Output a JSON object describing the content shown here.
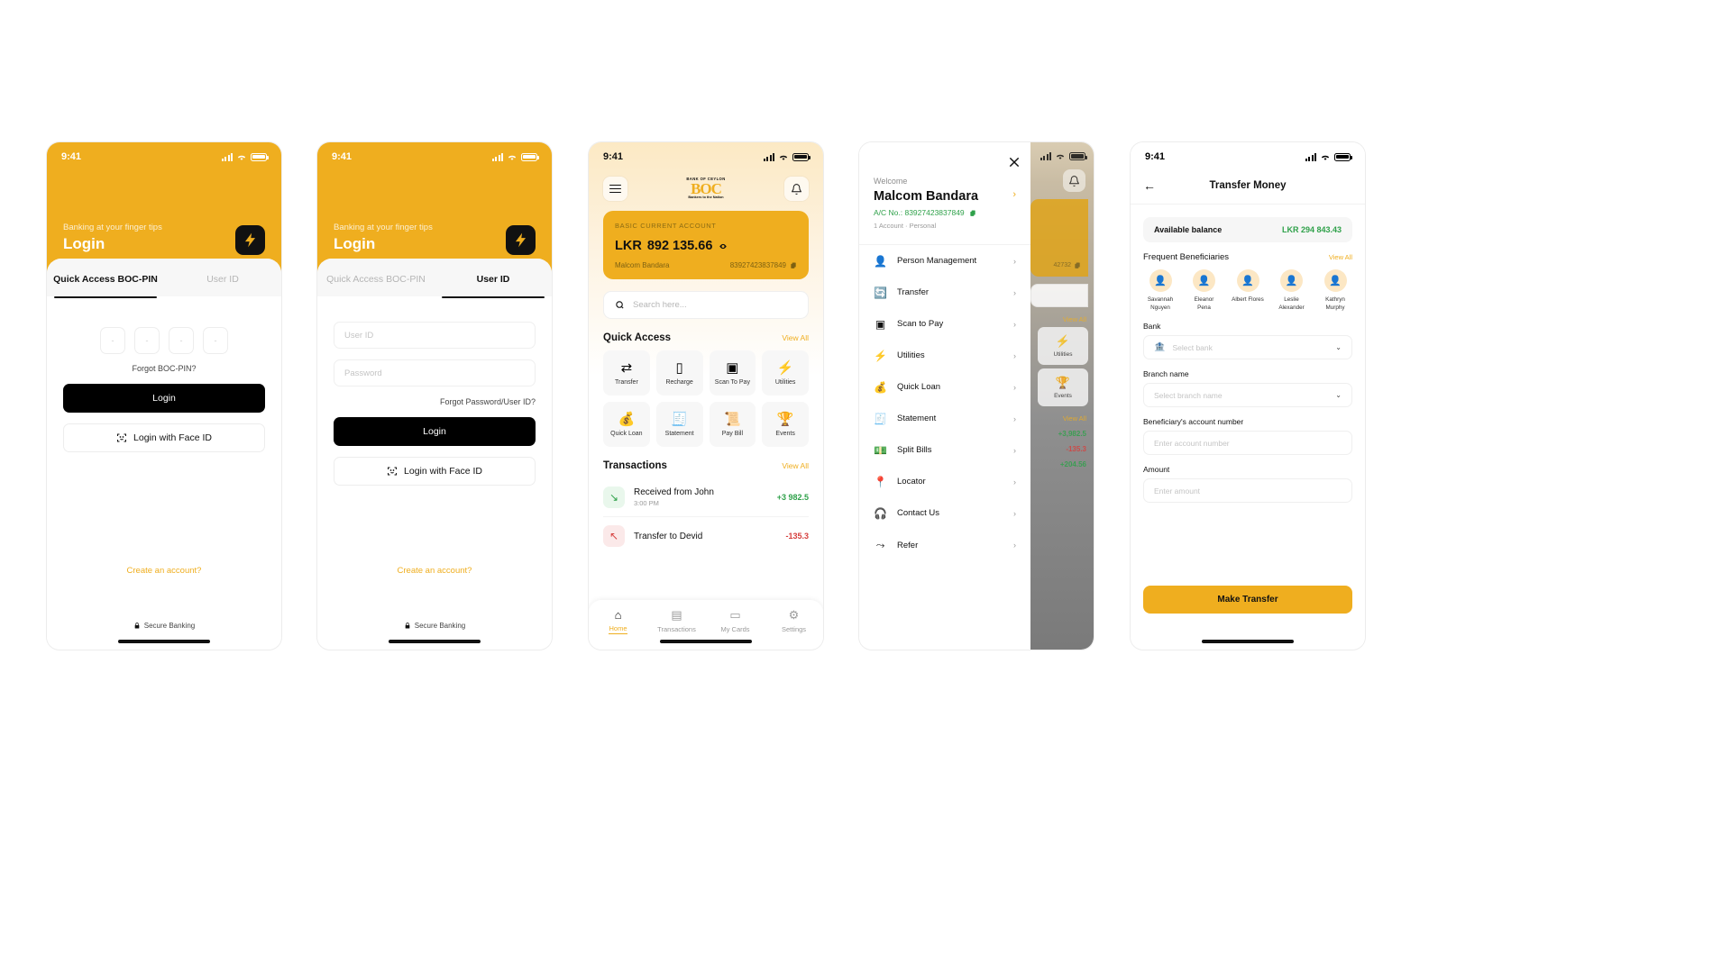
{
  "status_bar": {
    "time": "9:41"
  },
  "screen1": {
    "hero": {
      "subtitle": "Banking at your finger tips",
      "title": "Login",
      "logo_icon": "boc-bolt-logo"
    },
    "tabs": [
      {
        "label": "Quick Access BOC-PIN",
        "active": true
      },
      {
        "label": "User ID",
        "active": false
      }
    ],
    "pin_boxes": [
      "-",
      "-",
      "-",
      "-"
    ],
    "forgot_pin": "Forgot BOC-PIN?",
    "login_button": "Login",
    "faceid_button": "Login with Face ID",
    "create_account": "Create an account?",
    "secure_banking": "Secure Banking"
  },
  "screen2": {
    "hero": {
      "subtitle": "Banking at your finger tips",
      "title": "Login",
      "logo_icon": "boc-bolt-logo"
    },
    "tabs": [
      {
        "label": "Quick Access BOC-PIN",
        "active": false
      },
      {
        "label": "User ID",
        "active": true
      }
    ],
    "fields": [
      {
        "placeholder": "User ID",
        "value": ""
      },
      {
        "placeholder": "Password",
        "value": ""
      }
    ],
    "forgot_link": "Forgot Password/User ID?",
    "login_button": "Login",
    "faceid_button": "Login with Face ID",
    "create_account": "Create an account?",
    "secure_banking": "Secure Banking"
  },
  "screen3": {
    "brand": {
      "top": "BANK OF CEYLON",
      "mid": "BOC",
      "bottom": "Bankers to the Nation"
    },
    "card": {
      "type": "BASIC CURRENT ACCOUNT",
      "currency": "LKR",
      "balance": "892 135.66",
      "holder": "Malcom Bandara",
      "account_number": "83927423837849"
    },
    "search_placeholder": "Search here...",
    "quick_access": {
      "title": "Quick Access",
      "view_all": "View All",
      "items": [
        {
          "label": "Transfer",
          "icon": "transfer-arrows-icon",
          "glyph": "⇄"
        },
        {
          "label": "Recharge",
          "icon": "phone-recharge-icon",
          "glyph": "▯"
        },
        {
          "label": "Scan To Pay",
          "icon": "qr-scan-icon",
          "glyph": "▣"
        },
        {
          "label": "Utilities",
          "icon": "bolt-icon",
          "glyph": "⚡"
        },
        {
          "label": "Quick Loan",
          "icon": "money-bag-icon",
          "glyph": "💰"
        },
        {
          "label": "Statement",
          "icon": "document-icon",
          "glyph": "🧾"
        },
        {
          "label": "Pay Bill",
          "icon": "bill-icon",
          "glyph": "📜"
        },
        {
          "label": "Events",
          "icon": "trophy-icon",
          "glyph": "🏆"
        }
      ]
    },
    "transactions": {
      "title": "Transactions",
      "view_all": "View All",
      "items": [
        {
          "name": "Received from John",
          "time": "3:00 PM",
          "amount": "+3 982.5",
          "direction": "in"
        },
        {
          "name": "Transfer to Devid",
          "time": "",
          "amount": "-135.3",
          "direction": "out"
        }
      ]
    },
    "bottom_nav": [
      {
        "label": "Home",
        "icon": "home-icon",
        "glyph": "⌂",
        "active": true
      },
      {
        "label": "Transactions",
        "icon": "list-icon",
        "glyph": "▤",
        "active": false
      },
      {
        "label": "My Cards",
        "icon": "card-icon",
        "glyph": "▭",
        "active": false
      },
      {
        "label": "Settings",
        "icon": "gear-icon",
        "glyph": "⚙",
        "active": false
      }
    ]
  },
  "screen4": {
    "close_icon": "close-icon",
    "welcome": "Welcome",
    "name": "Malcom Bandara",
    "account_line": "A/C No.: 83927423837849",
    "meta": "1 Account · Personal",
    "menu": [
      {
        "label": "Person Management",
        "icon": "person-icon",
        "glyph": "👤"
      },
      {
        "label": "Transfer",
        "icon": "transfer-icon",
        "glyph": "🔄"
      },
      {
        "label": "Scan to Pay",
        "icon": "qr-scan-icon",
        "glyph": "▣"
      },
      {
        "label": "Utilities",
        "icon": "bolt-icon",
        "glyph": "⚡"
      },
      {
        "label": "Quick Loan",
        "icon": "money-bag-icon",
        "glyph": "💰"
      },
      {
        "label": "Statement",
        "icon": "document-icon",
        "glyph": "🧾"
      },
      {
        "label": "Split Bills",
        "icon": "split-bill-icon",
        "glyph": "💵"
      },
      {
        "label": "Locator",
        "icon": "location-pin-icon",
        "glyph": "📍"
      },
      {
        "label": "Contact Us",
        "icon": "headset-icon",
        "glyph": "🎧"
      },
      {
        "label": "Refer",
        "icon": "share-icon",
        "glyph": "⤳"
      }
    ],
    "peek": {
      "view_all": "View All",
      "account_number_tail": "42732",
      "tiles": [
        {
          "label": "Utilities",
          "glyph": "⚡"
        },
        {
          "label": "Events",
          "glyph": "🏆"
        }
      ],
      "amounts": [
        {
          "value": "+3,982.5",
          "positive": true
        },
        {
          "value": "-135.3",
          "positive": false
        },
        {
          "value": "+204.56",
          "positive": true
        }
      ]
    }
  },
  "screen5": {
    "back_icon": "back-arrow-icon",
    "title": "Transfer Money",
    "available_balance_label": "Available balance",
    "available_balance_value": "LKR 294 843.43",
    "beneficiaries_title": "Frequent Beneficiaries",
    "beneficiaries_view_all": "View All",
    "beneficiaries": [
      {
        "name": "Savannah Nguyen"
      },
      {
        "name": "Eleanor Pena"
      },
      {
        "name": "Albert Flores"
      },
      {
        "name": "Leslie Alexander"
      },
      {
        "name": "Kathryn Murphy"
      }
    ],
    "form": [
      {
        "label": "Bank",
        "placeholder": "Select bank",
        "icon": "bank-icon",
        "has_chevron": true
      },
      {
        "label": "Branch name",
        "placeholder": "Select branch name",
        "icon": "",
        "has_chevron": true
      },
      {
        "label": "Beneficiary's account number",
        "placeholder": "Enter account number",
        "icon": "",
        "has_chevron": false
      },
      {
        "label": "Amount",
        "placeholder": "Enter amount",
        "icon": "",
        "has_chevron": false
      }
    ],
    "submit_button": "Make Transfer"
  },
  "colors": {
    "brand": "#EFAE1F",
    "positive": "#2FA14A",
    "negative": "#D6403E",
    "dark": "#111111"
  }
}
